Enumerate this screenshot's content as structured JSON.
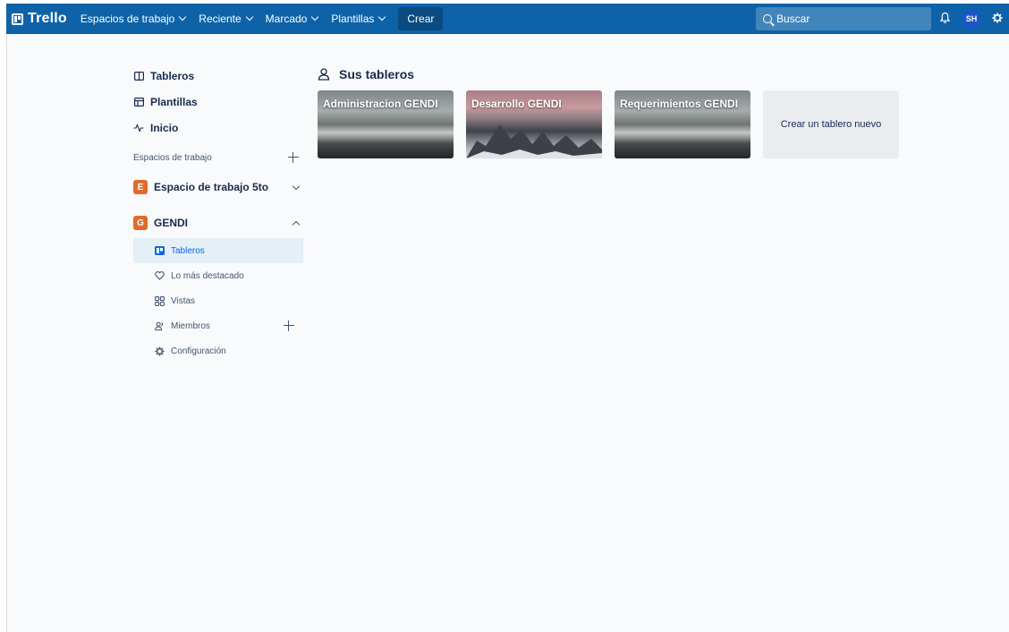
{
  "topbar": {
    "logo": "Trello",
    "nav": [
      {
        "label": "Espacios de trabajo"
      },
      {
        "label": "Reciente"
      },
      {
        "label": "Marcado"
      },
      {
        "label": "Plantillas"
      }
    ],
    "create_label": "Crear",
    "search_placeholder": "Buscar",
    "avatar_initials": "SH"
  },
  "sidebar": {
    "links": [
      {
        "label": "Tableros",
        "icon": "board-icon"
      },
      {
        "label": "Plantillas",
        "icon": "template-icon"
      },
      {
        "label": "Inicio",
        "icon": "activity-icon"
      }
    ],
    "workspaces_header": "Espacios de trabajo",
    "workspaces": [
      {
        "badge": "E",
        "name": "Espacio de trabajo 5to",
        "color": "#e06c2b",
        "expanded": false
      },
      {
        "badge": "G",
        "name": "GENDI",
        "color": "#e06c2b",
        "expanded": true
      }
    ],
    "sub_items": [
      {
        "label": "Tableros",
        "icon": "board-icon",
        "active": true
      },
      {
        "label": "Lo más destacado",
        "icon": "heart-icon"
      },
      {
        "label": "Vistas",
        "icon": "views-icon"
      },
      {
        "label": "Miembros",
        "icon": "members-icon"
      },
      {
        "label": "Configuración",
        "icon": "gear-icon"
      }
    ]
  },
  "main": {
    "title": "Sus tableros",
    "boards": [
      {
        "title": "Administracion GENDI",
        "background": "waves"
      },
      {
        "title": "Desarrollo GENDI",
        "background": "mountains"
      },
      {
        "title": "Requerimientos GENDI",
        "background": "waves"
      }
    ],
    "create_board_label": "Crear un tablero nuevo"
  },
  "colors": {
    "topbar": "#0e63a8",
    "accent": "#0c66e4",
    "workspace_badge": "#e06c2b"
  }
}
